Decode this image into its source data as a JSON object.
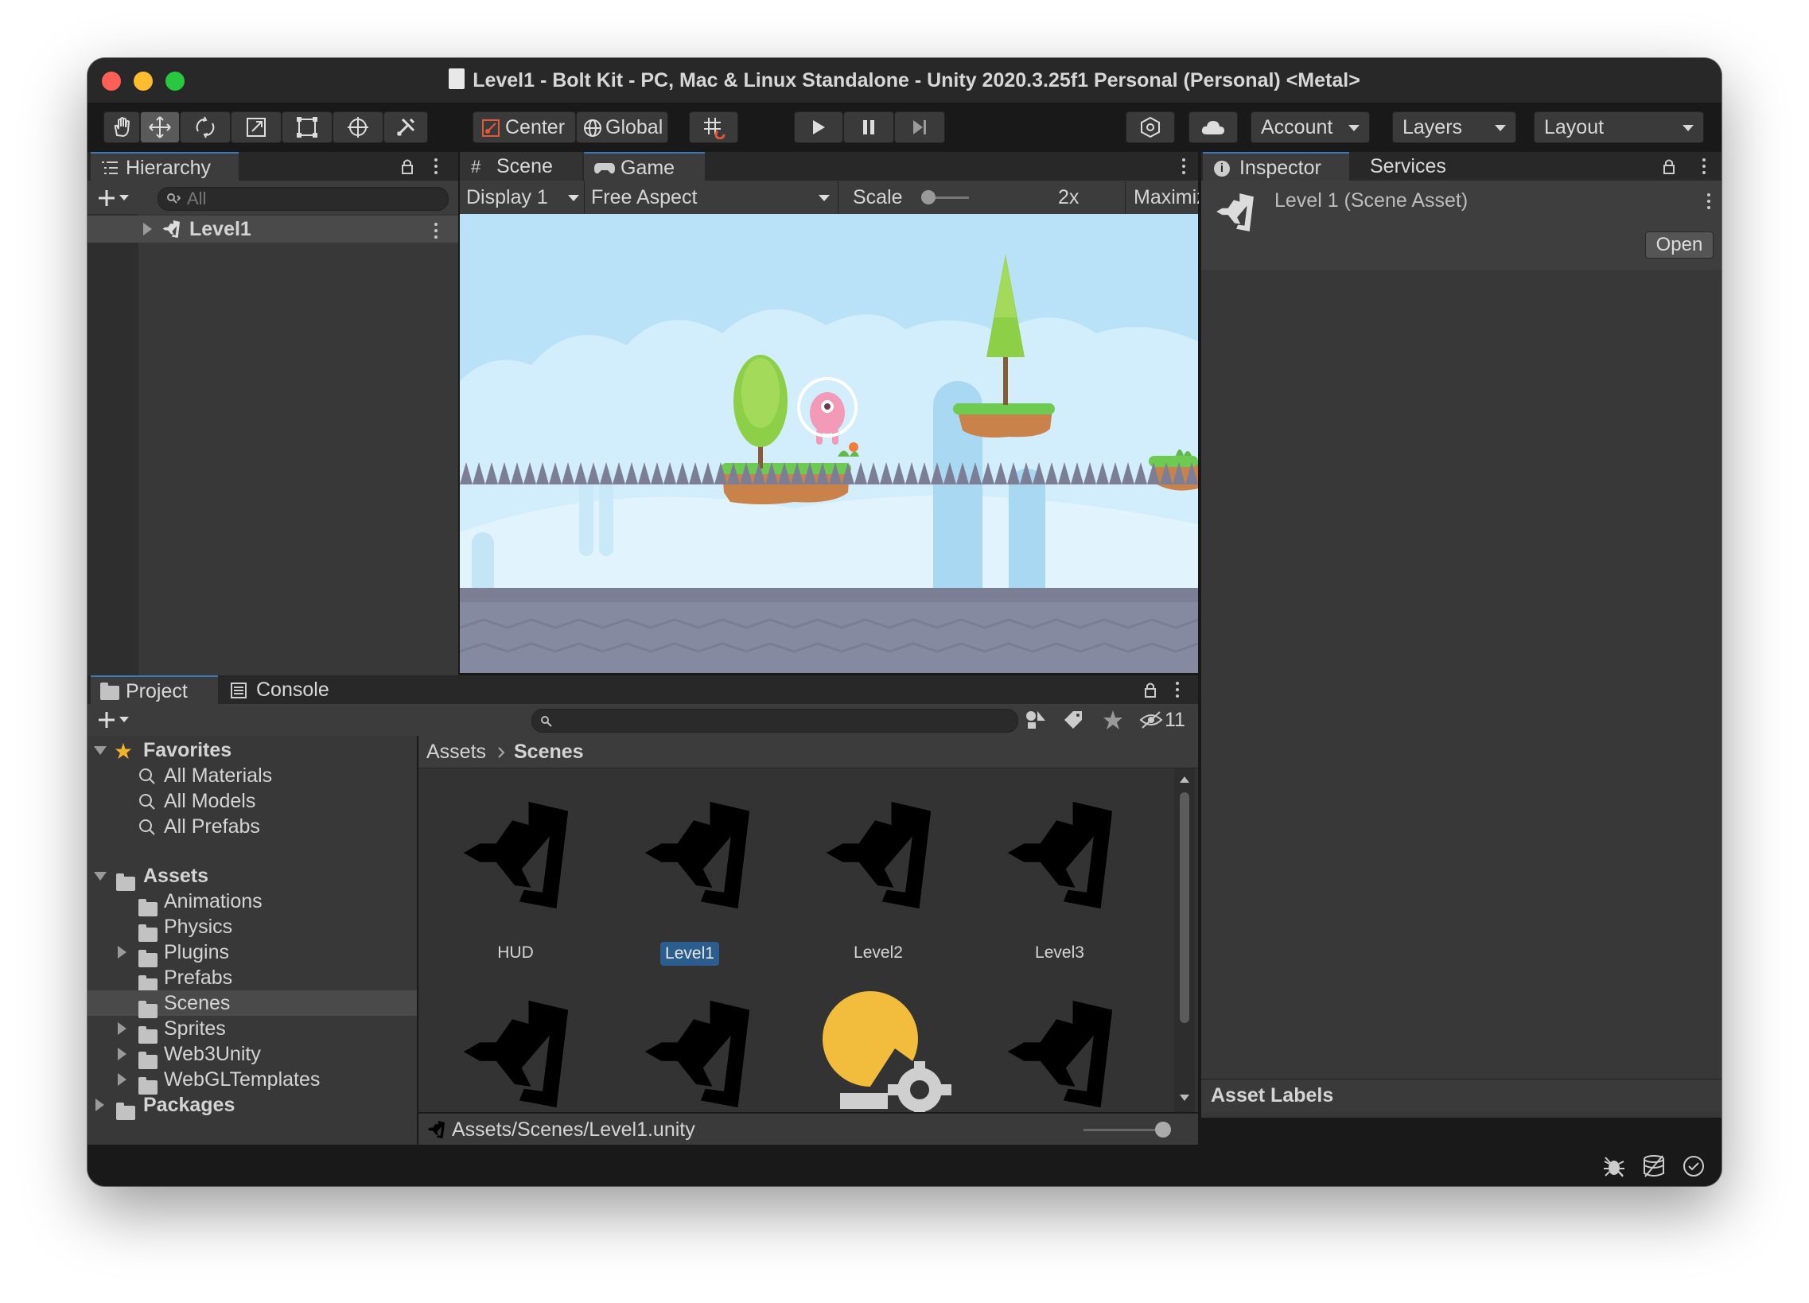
{
  "window": {
    "title": "Level1 - Bolt Kit - PC, Mac & Linux Standalone - Unity 2020.3.25f1 Personal (Personal) <Metal>"
  },
  "toolbar": {
    "center_label": "Center",
    "global_label": "Global",
    "account_label": "Account",
    "layers_label": "Layers",
    "layout_label": "Layout"
  },
  "hierarchy": {
    "tab_label": "Hierarchy",
    "search_placeholder": "All",
    "items": [
      {
        "label": "Level1"
      }
    ]
  },
  "game_view": {
    "tabs": [
      {
        "label": "Scene"
      },
      {
        "label": "Game"
      }
    ],
    "display_label": "Display 1",
    "aspect_label": "Free Aspect",
    "scale_label": "Scale",
    "scale_value": "2x",
    "maximize_label": "Maximize On Play"
  },
  "inspector": {
    "tabs": [
      {
        "label": "Inspector"
      },
      {
        "label": "Services"
      }
    ],
    "asset_title": "Level 1 (Scene Asset)",
    "open_label": "Open",
    "asset_labels": "Asset Labels"
  },
  "project": {
    "tabs": [
      {
        "label": "Project"
      },
      {
        "label": "Console"
      }
    ],
    "hidden_count": "11",
    "tree": {
      "favorites_label": "Favorites",
      "favorites": [
        {
          "label": "All Materials"
        },
        {
          "label": "All Models"
        },
        {
          "label": "All Prefabs"
        }
      ],
      "assets_label": "Assets",
      "folders": [
        {
          "label": "Animations"
        },
        {
          "label": "Physics"
        },
        {
          "label": "Plugins"
        },
        {
          "label": "Prefabs"
        },
        {
          "label": "Scenes"
        },
        {
          "label": "Sprites"
        },
        {
          "label": "Web3Unity"
        },
        {
          "label": "WebGLTemplates"
        }
      ],
      "packages_label": "Packages"
    },
    "breadcrumb": {
      "root": "Assets",
      "current": "Scenes"
    },
    "grid_items": [
      {
        "label": "HUD"
      },
      {
        "label": "Level1"
      },
      {
        "label": "Level2"
      },
      {
        "label": "Level3"
      }
    ],
    "path": "Assets/Scenes/Level1.unity"
  }
}
